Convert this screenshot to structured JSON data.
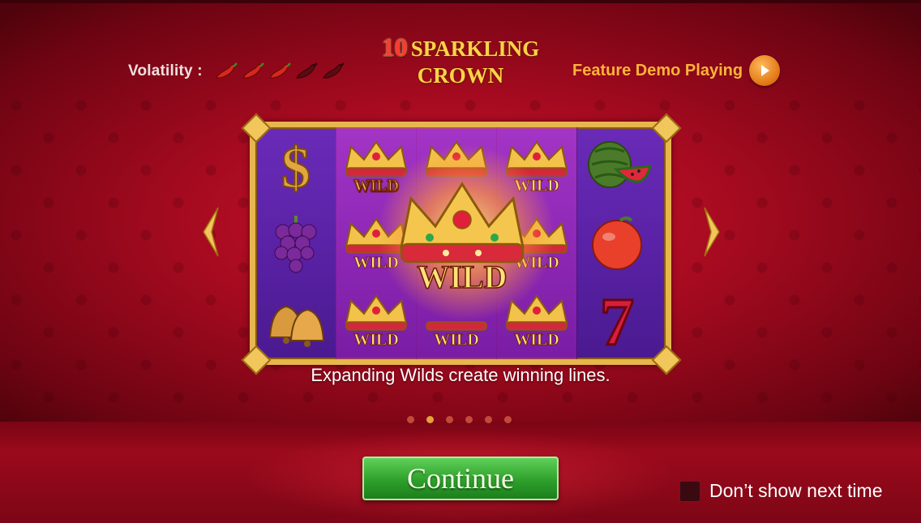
{
  "header": {
    "volatility_label": "Volatility",
    "volatility_separator": ":",
    "volatility_level": 3,
    "volatility_max": 5,
    "title_number": "10",
    "title_line1": "SPARKLING",
    "title_line2": "CROWN",
    "feature_demo_label": "Feature Demo Playing"
  },
  "slide": {
    "symbols": [
      "dollar-symbol",
      "grapes-symbol",
      "bells-symbol",
      "watermelon-symbol",
      "orange-symbol",
      "seven-symbol"
    ],
    "wild_label": "WILD",
    "caption": "Expanding Wilds create winning lines."
  },
  "pagination": {
    "total": 6,
    "active_index": 1
  },
  "buttons": {
    "continue_label": "Continue"
  },
  "options": {
    "dont_show_label": "Don’t show next time",
    "dont_show_checked": false
  },
  "colors": {
    "background_red": "#b20b22",
    "gold": "#e7b64c",
    "continue_green": "#2ea02b",
    "feature_orange": "#ffb23a"
  }
}
